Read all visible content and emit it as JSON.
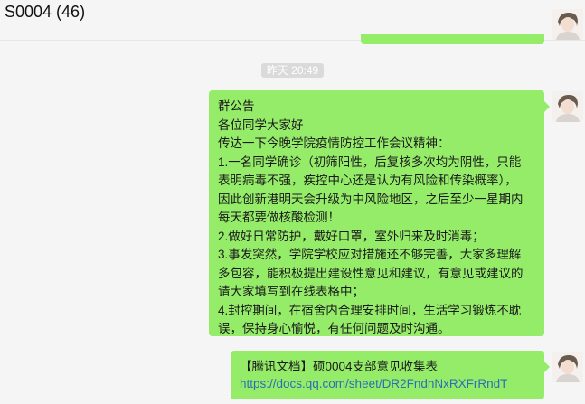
{
  "chat": {
    "title": "S0004 (46)"
  },
  "timestamp": "昨天 20:49",
  "announcement": {
    "lines": [
      "群公告",
      "各位同学大家好",
      "传达一下今晚学院疫情防控工作会议精神：",
      "1.一名同学确诊（初筛阳性，后复核多次均为阴性，只能",
      "表明病毒不强，疾控中心还是认为有风险和传染概率），",
      "因此创新港明天会升级为中风险地区，之后至少一星期内",
      "每天都要做核酸检测！",
      "2.做好日常防护，戴好口罩，室外归来及时消毒；",
      "3.事发突然，学院学校应对措施还不够完善，大家多理解",
      "多包容，能积极提出建设性意见和建议，有意见或建议的",
      "请大家填写到在线表格中；",
      "4.封控期间，在宿舍内合理安排时间，生活学习锻炼不耽",
      "误，保持身心愉悦，有任何问题及时沟通。"
    ]
  },
  "doc_message": {
    "title": "【腾讯文档】硕0004支部意见收集表",
    "link": "https://docs.qq.com/sheet/DR2FndnNxRXFrRndT"
  },
  "colors": {
    "bubble": "#95ec69",
    "background": "#f5f5f5",
    "link": "#2b6fb5"
  }
}
